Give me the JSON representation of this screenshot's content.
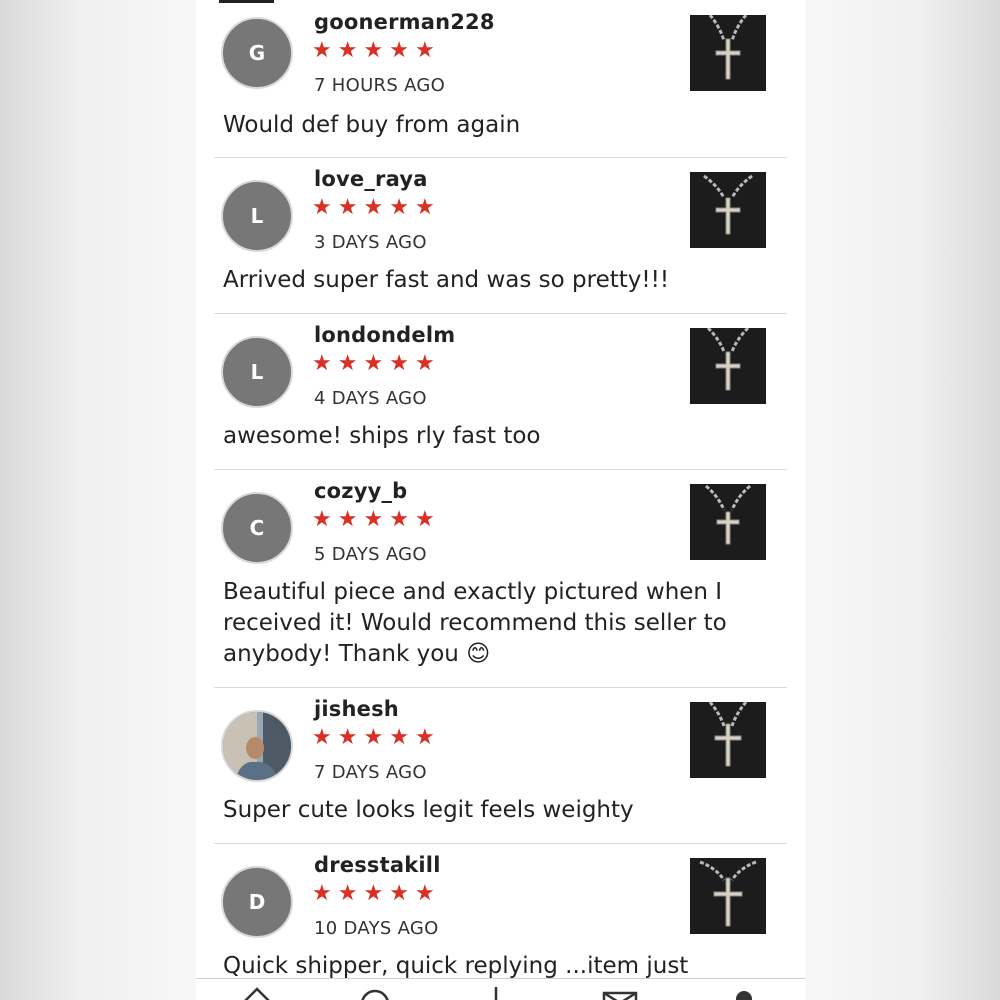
{
  "reviews": [
    {
      "username": "goonerman228",
      "initial": "G",
      "rating": 5,
      "time": "7 HOURS AGO",
      "text": "Would def buy from again",
      "avatar": "letter"
    },
    {
      "username": "love_raya",
      "initial": "L",
      "rating": 5,
      "time": "3 DAYS AGO",
      "text": "Arrived super fast and was so pretty!!!",
      "avatar": "letter"
    },
    {
      "username": "londondelm",
      "initial": "L",
      "rating": 5,
      "time": "4 DAYS AGO",
      "text": "awesome! ships rly fast too",
      "avatar": "letter"
    },
    {
      "username": "cozyy_b",
      "initial": "C",
      "rating": 5,
      "time": "5 DAYS AGO",
      "text": "Beautiful piece and exactly pictured when I received it! Would recommend this seller to anybody! Thank you 😊",
      "avatar": "letter"
    },
    {
      "username": "jishesh",
      "initial": "",
      "rating": 5,
      "time": "7 DAYS AGO",
      "text": "Super cute looks legit feels weighty",
      "avatar": "photo"
    },
    {
      "username": "dresstakill",
      "initial": "D",
      "rating": 5,
      "time": "10 DAYS AGO",
      "text": "Quick shipper, quick replying ...item just",
      "avatar": "letter"
    }
  ],
  "colors": {
    "star": "#d93025",
    "avatar_bg": "#777777"
  },
  "tabbar": {
    "icons": [
      "home-icon",
      "search-icon",
      "sell-icon",
      "messages-icon",
      "profile-icon"
    ]
  }
}
